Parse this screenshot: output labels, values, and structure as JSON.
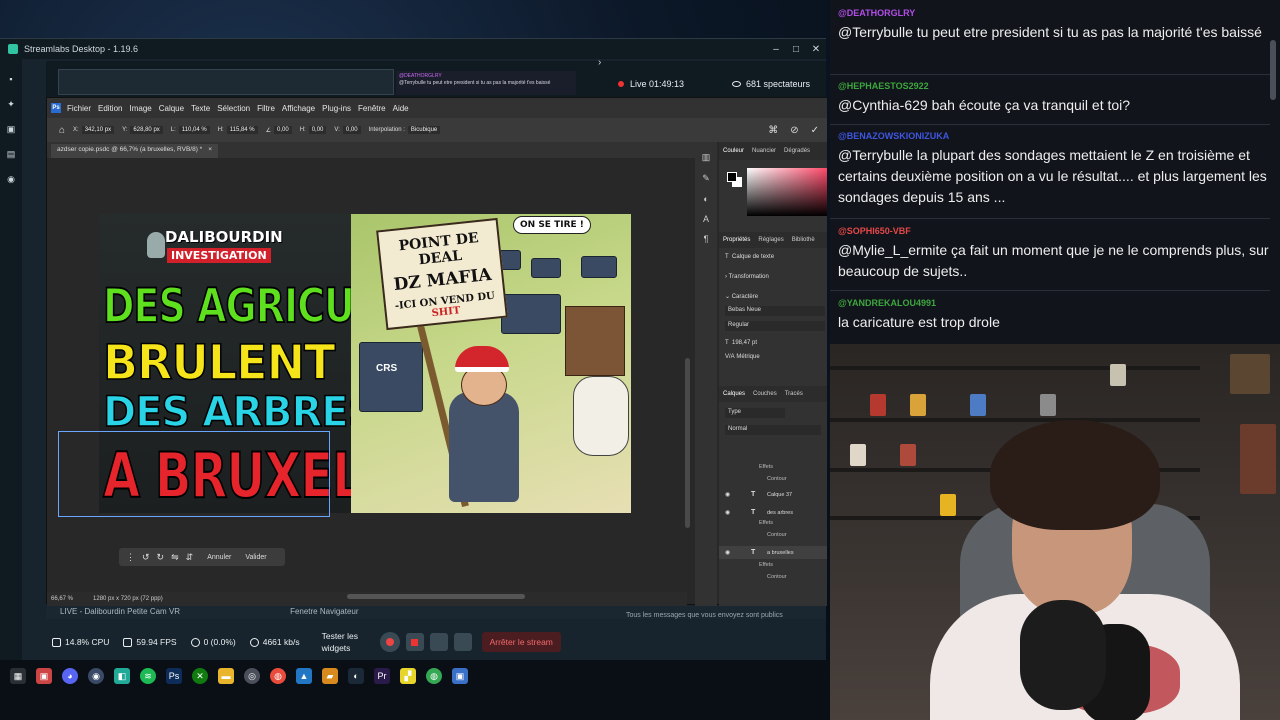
{
  "streamlabs": {
    "title": "Streamlabs Desktop - 1.19.6",
    "live_label": "Live 01:49:13",
    "viewers": "681 spectateurs",
    "scenes": [
      "LIVE - Dalibourdin Petite Cam VR",
      "Fenetre Navigateur"
    ],
    "notice": "Tous les messages que vous envoyez sont publics",
    "footer": {
      "cpu": "14.8% CPU",
      "fps": "59.94 FPS",
      "dropped": "0 (0.0%)",
      "bitrate": "4661 kb/s",
      "test_widgets": "Tester les widgets",
      "stop_stream": "Arrêter le stream"
    },
    "mini_chat": {
      "user": "@DEATHORGLRY",
      "text": "@Terrybulle tu peut etre president si tu as pas la majorité t'es baissé"
    }
  },
  "photoshop": {
    "menu": [
      "Fichier",
      "Edition",
      "Image",
      "Calque",
      "Texte",
      "Sélection",
      "Filtre",
      "Affichage",
      "Plug-ins",
      "Fenêtre",
      "Aide"
    ],
    "options": {
      "x": "342,10 px",
      "y": "628,80 px",
      "w": "110,04 %",
      "h": "115,84 %",
      "angle": "0,00",
      "hskew": "0,00",
      "vskew": "0,00",
      "interpolation_label": "Interpolation :",
      "interpolation": "Bicubique"
    },
    "doc_tab": "azdser copie.psdc @ 66,7% (a bruxelles, RVB/8) *",
    "status": {
      "zoom": "66,67 %",
      "size": "1280 px x 720 px (72 ppp)"
    },
    "float_bar": {
      "cancel": "Annuler",
      "validate": "Valider"
    },
    "panel": {
      "color_tabs": [
        "Couleur",
        "Nuancier",
        "Dégradés"
      ],
      "prop_tabs": [
        "Propriétés",
        "Réglages",
        "Bibliothè"
      ],
      "layer_kind": "Calque de texte",
      "transformation": "Transformation",
      "character": "Caractère",
      "font": "Bebas Neue",
      "style": "Regular",
      "size": "198,47 pt",
      "metric": "Métrique",
      "layers_tabs": [
        "Calques",
        "Couches",
        "Tracés"
      ],
      "filter": "Type",
      "blend": "Normal",
      "effects": "Effets",
      "contour": "Contour",
      "layers": [
        "Calque 37",
        "des arbres",
        "a bruxelles"
      ]
    }
  },
  "thumbnail": {
    "logo_line1": "DALIBOURDIN",
    "logo_line2": "INVESTIGATION",
    "headline": [
      "DES AGRICULTEURS",
      "BRULENT",
      "DES ARBRES",
      "A BRUXELLES"
    ],
    "sign": {
      "line1": "POINT DE DEAL",
      "line2": "DZ MAFIA",
      "line3_pre": "-ICI ON VEND DU ",
      "line3_hl": "SHIT"
    },
    "bubble": "ON SE TIRE !",
    "van_label": "CRS"
  },
  "chat": [
    {
      "user": "@DEATHORGLRY",
      "text": "@Terrybulle tu peut etre president si tu as pas la majorité t'es baissé"
    },
    {
      "user": "@HEPHAESTOS2922",
      "text": "@Cynthia-629 bah écoute ça va tranquil et toi?"
    },
    {
      "user": "@BENAZOWSKIONIZUKA",
      "text": "@Terrybulle la plupart des sondages mettaient le Z en troisième et certains deuxième position on a vu le résultat.... et plus largement les sondages depuis 15 ans ..."
    },
    {
      "user": "@SOPHI650-VBF",
      "text": "@Mylie_L_ermite ça fait un moment que je ne le comprends plus, sur beaucoup de sujets.."
    },
    {
      "user": "@YANDREKALOU4991",
      "text": "la caricature est trop drole"
    }
  ],
  "colors": {
    "chat_user_purple": "#b14ee8",
    "chat_user_green": "#3da73d",
    "chat_user_blue": "#3f56e0",
    "chat_user_red": "#e64848",
    "headline_green": "#5ee01f",
    "headline_yellow": "#f5e41a",
    "headline_cyan": "#29d4e6",
    "headline_red": "#e5242b"
  }
}
